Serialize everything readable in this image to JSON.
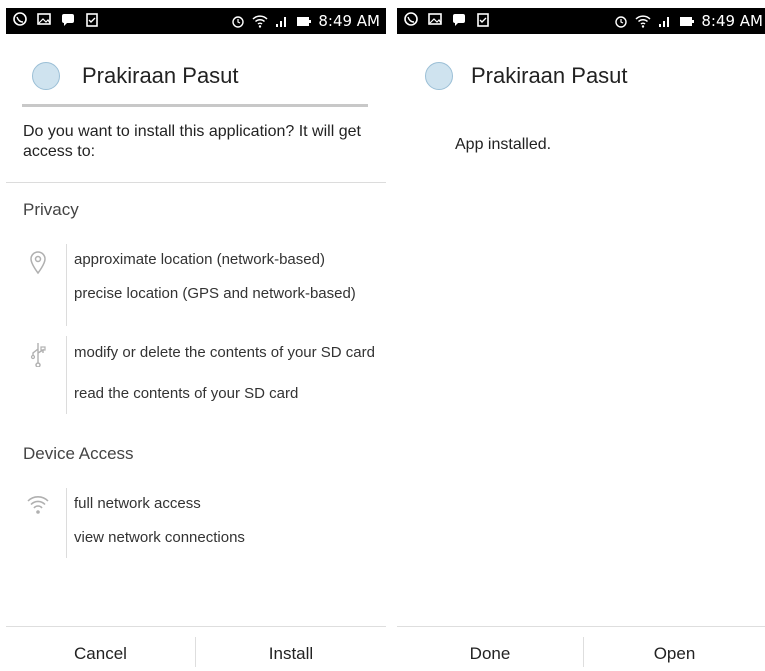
{
  "statusbar": {
    "time": "8:49 AM"
  },
  "left": {
    "app_title": "Prakiraan Pasut",
    "question": "Do you want to install this application? It will get access to:",
    "sections": [
      {
        "title": "Privacy",
        "groups": [
          {
            "icon": "location-icon",
            "items": [
              "approximate location (network-based)",
              "precise location (GPS and network-based)"
            ]
          },
          {
            "icon": "usb-icon",
            "items": [
              "modify or delete the contents of your SD card",
              "read the contents of your SD card"
            ]
          }
        ]
      },
      {
        "title": "Device Access",
        "groups": [
          {
            "icon": "wifi-icon",
            "items": [
              "full network access",
              "view network connections"
            ]
          }
        ]
      }
    ],
    "buttons": {
      "cancel": "Cancel",
      "install": "Install"
    }
  },
  "right": {
    "app_title": "Prakiraan Pasut",
    "message": "App installed.",
    "buttons": {
      "done": "Done",
      "open": "Open"
    }
  }
}
